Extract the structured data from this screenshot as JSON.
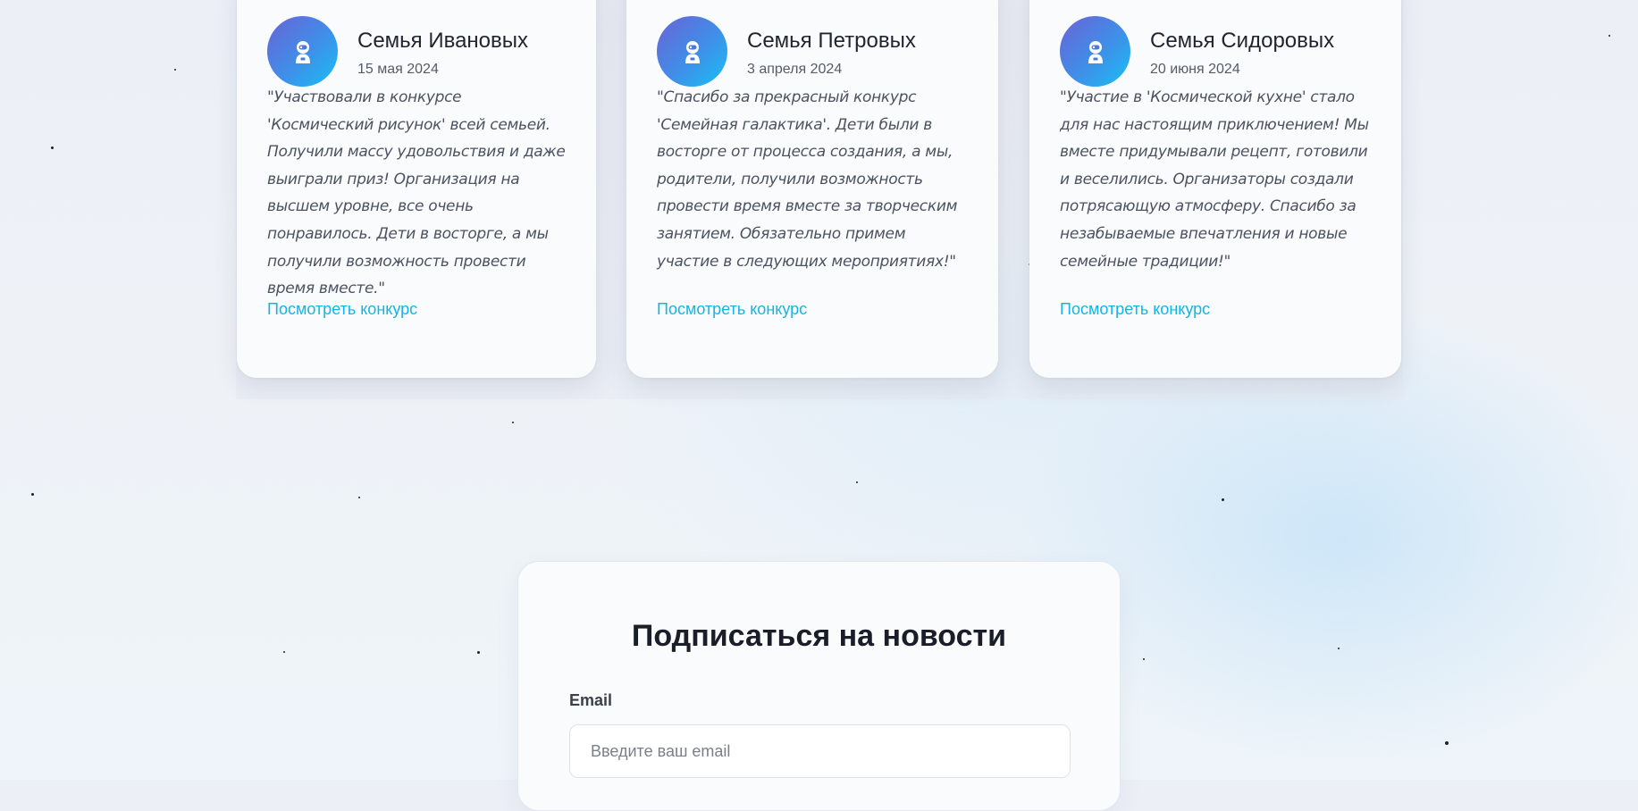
{
  "reviews": [
    {
      "family": "Семья Ивановых",
      "date": "15 мая 2024",
      "text": "\"Участвовали в конкурсе 'Космический рисунок' всей семьей. Получили массу удовольствия и даже выиграли приз! Организация на высшем уровне, все очень понравилось. Дети в восторге, а мы получили возможность провести время вместе.\"",
      "link_label": "Посмотреть конкурс",
      "avatar_icon": "astronaut-icon"
    },
    {
      "family": "Семья Петровых",
      "date": "3 апреля 2024",
      "text": "\"Спасибо за прекрасный конкурс 'Семейная галактика'. Дети были в восторге от процесса создания, а мы, родители, получили возможность провести время вместе за творческим занятием. Обязательно примем участие в следующих мероприятиях!\"",
      "link_label": "Посмотреть конкурс",
      "avatar_icon": "astronaut-icon"
    },
    {
      "family": "Семья Сидоровых",
      "date": "20 июня 2024",
      "text": "\"Участие в 'Космической кухне' стало для нас настоящим приключением! Мы вместе придумывали рецепт, готовили и веселились. Организаторы создали потрясающую атмосферу. Спасибо за незабываемые впечатления и новые семейные традиции!\"",
      "link_label": "Посмотреть конкурс",
      "avatar_icon": "astronaut-icon"
    }
  ],
  "subscribe": {
    "title": "Подписаться на новости",
    "email_label": "Email",
    "email_placeholder": "Введите ваш email",
    "email_value": ""
  },
  "colors": {
    "accent_link": "#13b5e4",
    "avatar_gradient_start": "#6a63d6",
    "avatar_gradient_end": "#17c0f5"
  }
}
